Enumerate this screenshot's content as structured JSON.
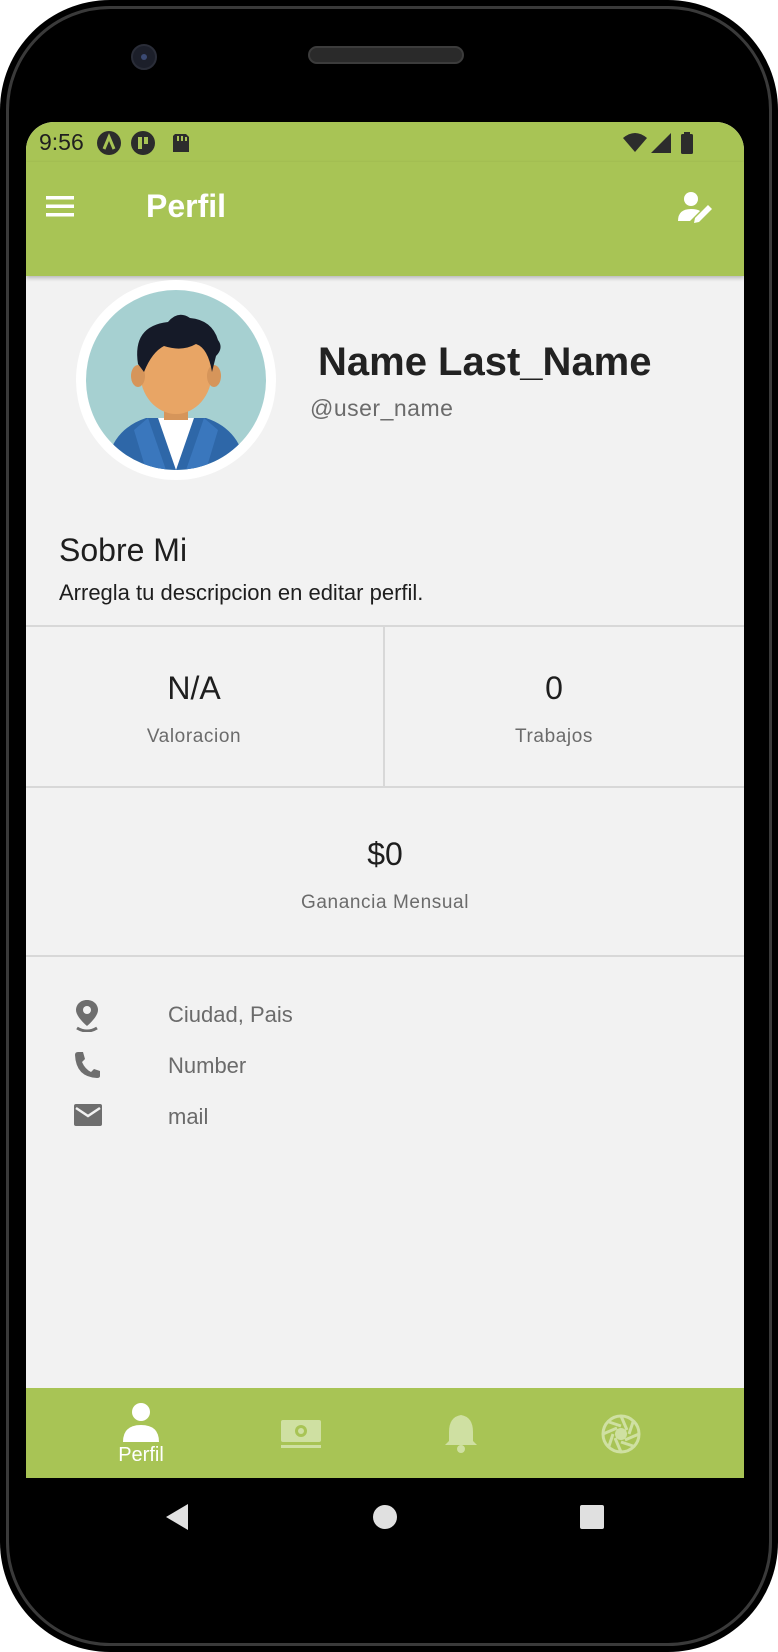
{
  "status_bar": {
    "time": "9:56"
  },
  "app_bar": {
    "title": "Perfil",
    "menu_icon": "menu-icon",
    "edit_icon": "edit-profile-icon"
  },
  "profile": {
    "full_name": "Name Last_Name",
    "username": "@user_name",
    "about_title": "Sobre Mi",
    "about_text": "Arregla tu descripcion en editar perfil."
  },
  "stats": {
    "rating_value": "N/A",
    "rating_label": "Valoracion",
    "jobs_value": "0",
    "jobs_label": "Trabajos",
    "earnings_value": "$0",
    "earnings_label": "Ganancia Mensual"
  },
  "contact": [
    {
      "icon": "location-icon",
      "text": "Ciudad, Pais"
    },
    {
      "icon": "phone-icon",
      "text": "Number"
    },
    {
      "icon": "mail-icon",
      "text": "mail"
    }
  ],
  "bottom_nav": {
    "items": [
      {
        "icon": "person-icon",
        "label": "Perfil",
        "active": true
      },
      {
        "icon": "money-icon",
        "label": "",
        "active": false
      },
      {
        "icon": "bell-icon",
        "label": "",
        "active": false
      },
      {
        "icon": "aperture-icon",
        "label": "",
        "active": false
      }
    ]
  },
  "colors": {
    "accent": "#a8c455",
    "background": "#f2f2f2",
    "nav_inactive": "#cfe0a2"
  }
}
